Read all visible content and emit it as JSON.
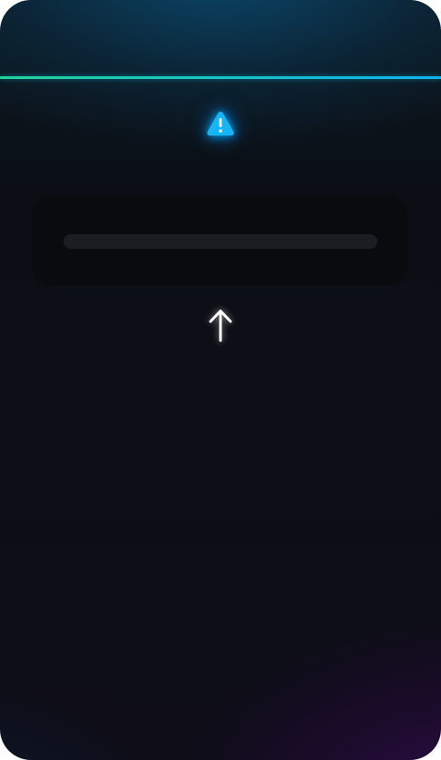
{
  "screen": {
    "top_accent": {
      "color_start": "#22d39a",
      "color_end": "#0fb2ef"
    },
    "warning": {
      "icon": "warning-triangle-icon",
      "color": "#1ab8f5"
    },
    "input_card": {
      "loading_bar": "placeholder"
    },
    "action": {
      "icon": "up-arrow-icon",
      "color": "#ffffff"
    }
  }
}
